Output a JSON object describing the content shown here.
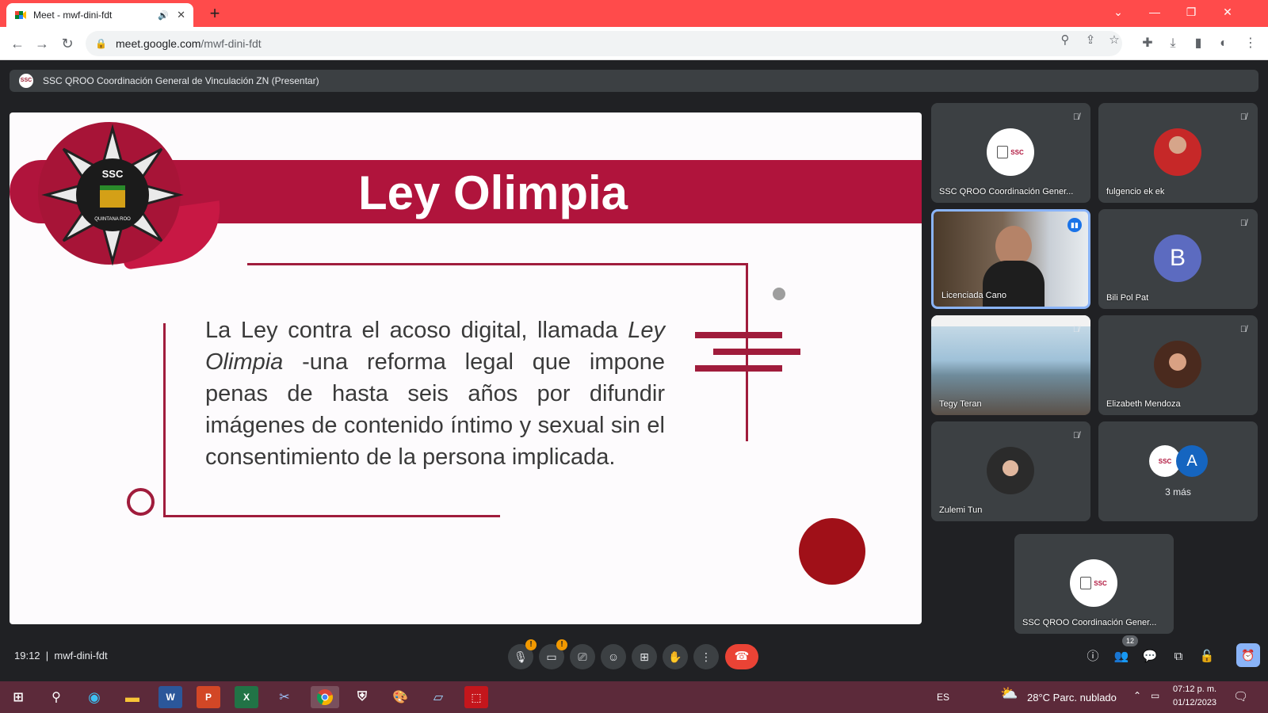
{
  "browser": {
    "tab_title": "Meet - mwf-dini-fdt",
    "url_host": "meet.google.com",
    "url_path": "/mwf-dini-fdt",
    "new_tab_glyph": "+",
    "tab_close_glyph": "✕"
  },
  "meet": {
    "presenter_label": "SSC QROO Coordinación General de Vinculación ZN (Presentar)",
    "slide": {
      "title": "Ley Olimpia",
      "body_part1": "La Ley contra el acoso digital, llamada ",
      "body_italic": "Ley Olimpia",
      "body_part2": " -una reforma legal que impone penas de hasta seis años por difundir imágenes de contenido íntimo y sexual sin el consentimiento de la persona implicada.",
      "logo_text": "SSC",
      "logo_subtext": "QUINTANA ROO"
    },
    "participants": [
      {
        "name": "SSC QROO Coordinación Gener...",
        "type": "logo",
        "muted": true
      },
      {
        "name": "fulgencio ek ek",
        "type": "photo",
        "muted": true
      },
      {
        "name": "Licenciada Cano",
        "type": "video",
        "speaking": true
      },
      {
        "name": "Bili Pol Pat",
        "type": "initial",
        "initial": "B",
        "muted": true
      },
      {
        "name": "Tegy Teran",
        "type": "video",
        "muted": true
      },
      {
        "name": "Elizabeth Mendoza",
        "type": "photo",
        "muted": true
      },
      {
        "name": "Zulemi Tun",
        "type": "photo",
        "muted": true
      },
      {
        "name": "3 más",
        "type": "more",
        "initial": "A"
      },
      {
        "name": "SSC QROO Coordinación Gener...",
        "type": "logo"
      }
    ],
    "logo_badge_text": "SSC",
    "bottom": {
      "time": "19:12",
      "separator": "|",
      "meeting_code": "mwf-dini-fdt",
      "warn_glyph": "!",
      "participant_count": "12"
    }
  },
  "taskbar": {
    "lang": "ES",
    "weather": "28°C  Parc. nublado",
    "time": "07:12 p. m.",
    "date": "01/12/2023",
    "apps": [
      "W",
      "P",
      "X"
    ]
  },
  "colors": {
    "tabbar": "#ff4b4b",
    "slide_banner": "#b0143c",
    "meet_bg": "#202124",
    "end_call": "#ea4335",
    "taskbar": "#5c2a3a",
    "active_tile_border": "#8ab4f8"
  }
}
